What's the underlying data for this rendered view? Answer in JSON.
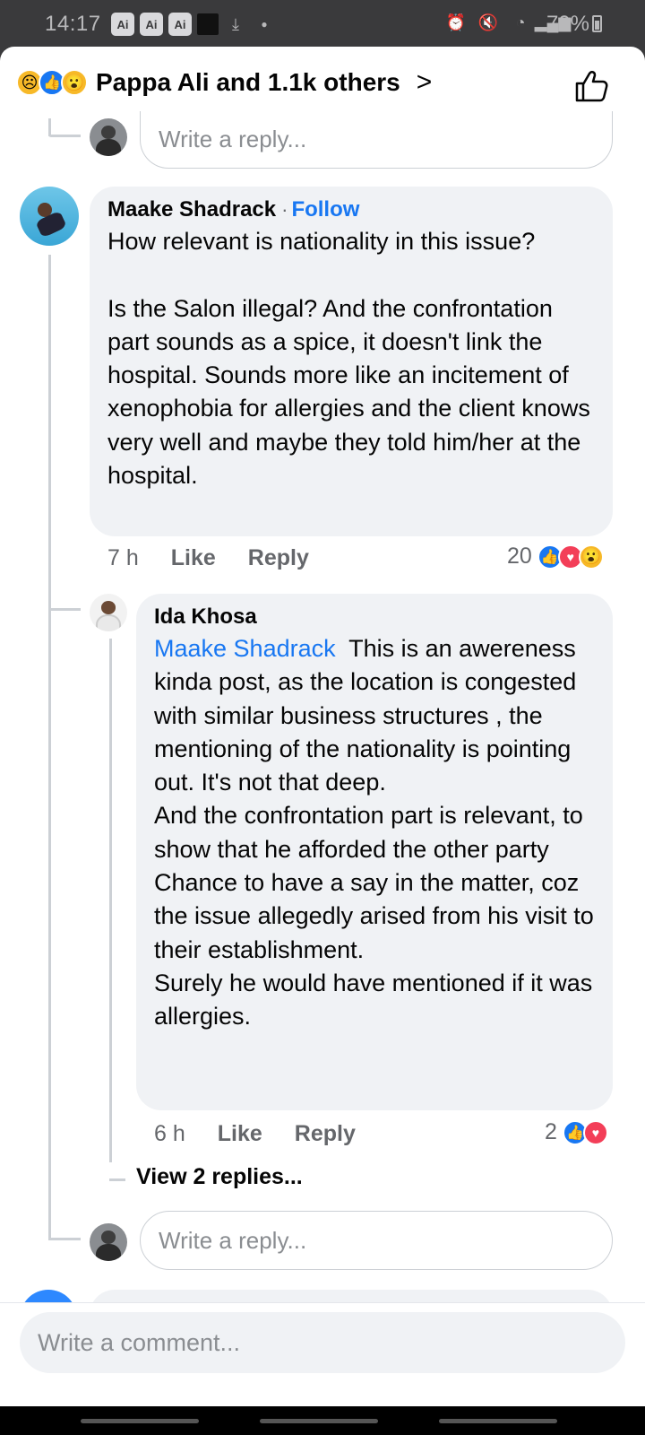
{
  "status_bar": {
    "time": "14:17",
    "badges": [
      "Ai",
      "Ai",
      "Ai"
    ],
    "battery": "70%"
  },
  "reactions_header": {
    "title": "Pappa Ali and 1.1k others",
    "reaction_icons": [
      "sad-icon",
      "like-icon",
      "wow-icon"
    ]
  },
  "top_reply_input": {
    "placeholder": "Write a reply..."
  },
  "comment1": {
    "author": "Maake Shadrack",
    "follow_label": "Follow",
    "text": "How relevant is nationality in this issue?\n\nIs the Salon illegal? And the confrontation part sounds as a spice, it doesn't link the hospital. Sounds more like an incitement of xenophobia for allergies and the client knows very well and maybe they told him/her at the hospital.",
    "time": "7 h",
    "like_label": "Like",
    "reply_label": "Reply",
    "reaction_count": "20",
    "reaction_icons": [
      "like-icon",
      "love-icon",
      "wow-icon"
    ]
  },
  "reply1": {
    "author": "Ida Khosa",
    "mention": "Maake Shadrack",
    "text": "  This is an awereness kinda post, as the location is congested with similar business structures , the mentioning of the nationality is pointing out. It's not that deep.\nAnd the confrontation part is relevant, to show that he afforded the other party Chance to have a say in the matter, coz the issue allegedly arised from his visit to their establishment.\nSurely he would have mentioned if it was allergies.",
    "time": "6 h",
    "like_label": "Like",
    "reply_label": "Reply",
    "reaction_count": "2",
    "reaction_icons": [
      "like-icon",
      "love-icon"
    ]
  },
  "view_replies": "View 2 replies...",
  "bottom_reply_input": {
    "placeholder": "Write a reply..."
  },
  "comment_bar": {
    "placeholder": "Write a comment..."
  }
}
